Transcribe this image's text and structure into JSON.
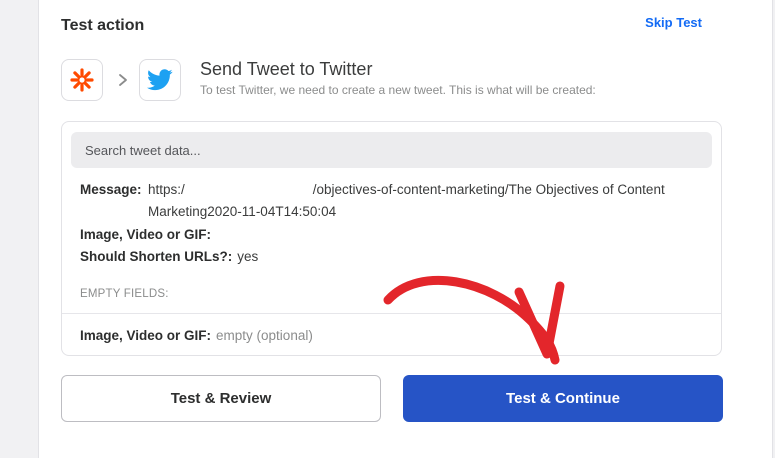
{
  "header": {
    "title": "Test action",
    "skip_label": "Skip Test"
  },
  "step": {
    "source_icon": "zapier-asterisk-icon",
    "target_icon": "twitter-bird-icon",
    "title": "Send Tweet to Twitter",
    "subtitle": "To test Twitter, we need to create a new tweet. This is what will be created:"
  },
  "search": {
    "placeholder": "Search tweet data..."
  },
  "fields": {
    "message_label": "Message:",
    "message_value_prefix": "https:/",
    "message_value_rest": "/objectives-of-content-marketing/The Objectives of Content Marketing2020-11-04T14:50:04",
    "image_label": "Image, Video or GIF:",
    "image_value": "",
    "shorten_label": "Should Shorten URLs?:",
    "shorten_value": "yes"
  },
  "empty_fields": {
    "heading": "EMPTY FIELDS:",
    "items": [
      {
        "label": "Image, Video or GIF:",
        "value": "empty (optional)"
      }
    ]
  },
  "buttons": {
    "review_label": "Test & Review",
    "continue_label": "Test & Continue"
  },
  "colors": {
    "primary": "#2654c6",
    "link": "#136bf5",
    "zapier_orange": "#ff4a00",
    "twitter_blue": "#1da1f2",
    "annotation_arrow": "#e3262b"
  }
}
